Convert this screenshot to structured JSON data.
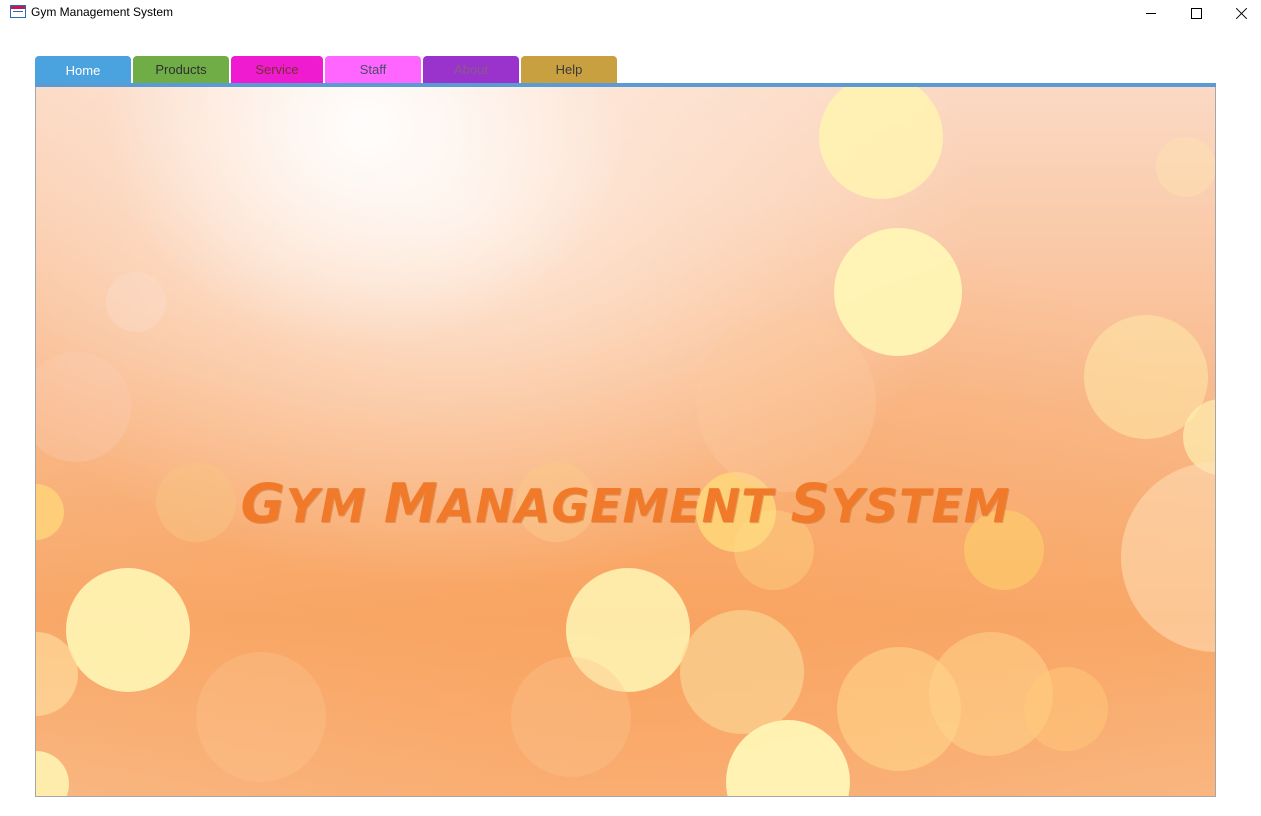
{
  "window": {
    "title": "Gym Management System",
    "icon": "form-icon",
    "controls": [
      "minimize",
      "maximize",
      "close"
    ]
  },
  "tabs": [
    {
      "label": "Home",
      "bg": "#4aa3df",
      "fg": "#ffffff",
      "selected": true
    },
    {
      "label": "Products",
      "bg": "#70ad47",
      "fg": "#2f2f2f",
      "selected": false
    },
    {
      "label": "Service",
      "bg": "#ee1bd0",
      "fg": "#7a2f2f",
      "selected": false
    },
    {
      "label": "Staff",
      "bg": "#ff66ff",
      "fg": "#4a4a6a",
      "selected": false
    },
    {
      "label": "About",
      "bg": "#9933cc",
      "fg": "#8a5a8a",
      "selected": false
    },
    {
      "label": "Help",
      "bg": "#c9a040",
      "fg": "#3a3a3a",
      "selected": false
    }
  ],
  "accent_color": "#5b9bd5",
  "home": {
    "banner_text": "Gym Management System",
    "banner_color": "#f07a2a"
  }
}
